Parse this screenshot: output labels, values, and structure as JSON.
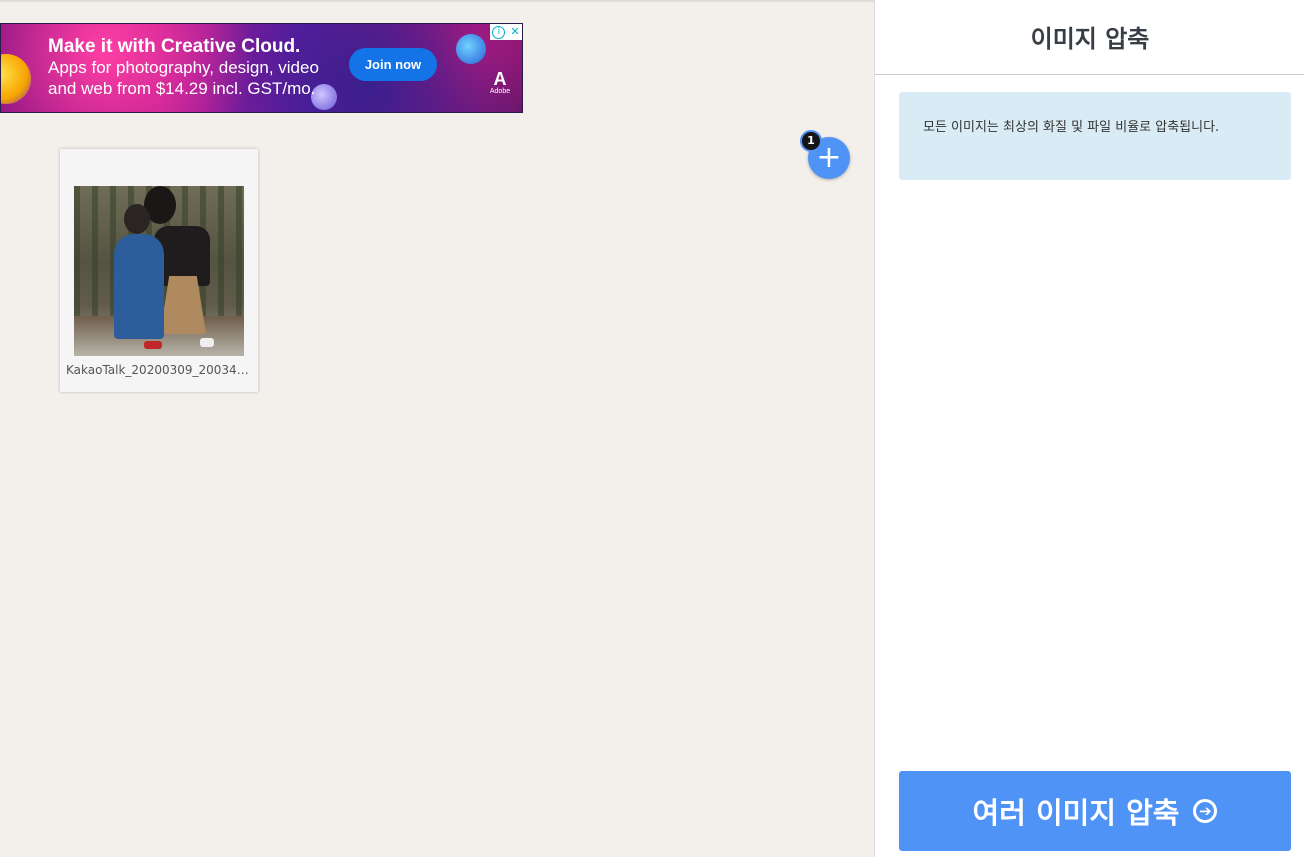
{
  "ad": {
    "headline": "Make it with Creative Cloud.",
    "body": "Apps for photography, design, video and web from $14.29 incl. GST/mo.",
    "cta": "Join now",
    "brand": "Adobe",
    "brand_mark": "A",
    "info_icon": "i",
    "close_icon": "✕"
  },
  "files": [
    {
      "name": "KakaoTalk_20200309_200349…"
    }
  ],
  "add_button": {
    "icon": "plus-icon",
    "glyph": "+",
    "count": "1"
  },
  "sidebar": {
    "title": "이미지 압축",
    "notice": "모든 이미지는 최상의 화질 및 파일 비율로 압축됩니다.",
    "compress_button": "여러 이미지 압축",
    "compress_icon": "➔"
  },
  "colors": {
    "accent": "#4f93f6",
    "notice_bg": "#d9ebf5",
    "canvas_bg": "#f3f0ec"
  }
}
